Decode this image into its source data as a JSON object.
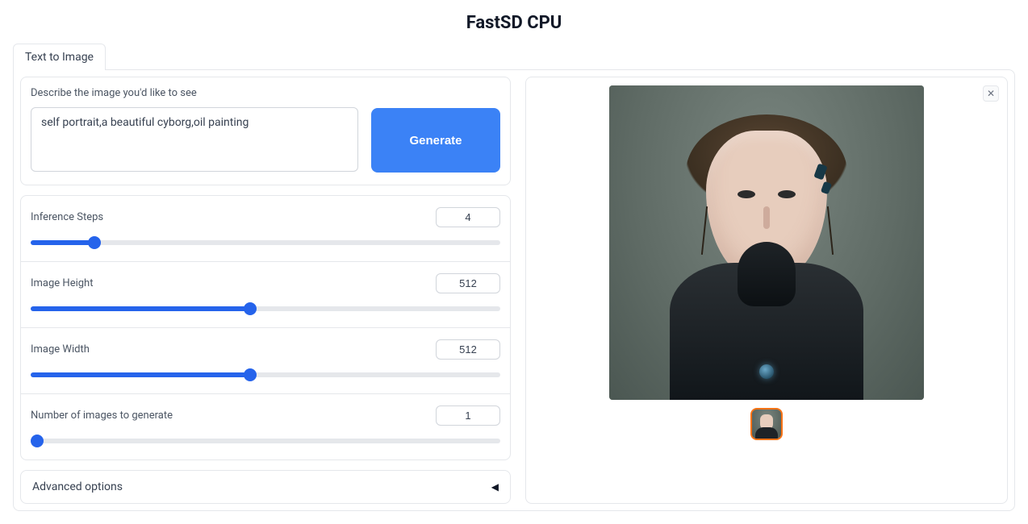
{
  "title": "FastSD CPU",
  "tabs": {
    "text_to_image": "Text to Image"
  },
  "prompt": {
    "label": "Describe the image you'd like to see",
    "value": "self portrait,a beautiful cyborg,oil painting"
  },
  "generate_label": "Generate",
  "sliders": {
    "steps": {
      "label": "Inference Steps",
      "value": 4,
      "min": 1,
      "max": 25
    },
    "height": {
      "label": "Image Height",
      "value": 512,
      "min": 64,
      "max": 1024
    },
    "width": {
      "label": "Image Width",
      "value": 512,
      "min": 64,
      "max": 1024
    },
    "count": {
      "label": "Number of images to generate",
      "value": 1,
      "min": 1,
      "max": 50
    }
  },
  "advanced_label": "Advanced options",
  "output": {
    "close_glyph": "✕",
    "caret_glyph": "◀"
  }
}
